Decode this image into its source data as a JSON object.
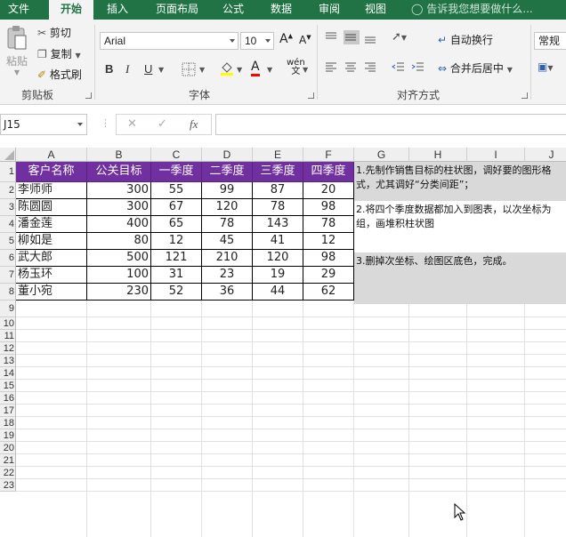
{
  "ribbon_tabs": [
    "文件",
    "开始",
    "插入",
    "页面布局",
    "公式",
    "数据",
    "审阅",
    "视图"
  ],
  "tell_me": "告诉我您想要做什么...",
  "clipboard": {
    "paste": "粘贴",
    "cut": "剪切",
    "copy": "复制",
    "format_painter": "格式刷",
    "group_label": "剪贴板"
  },
  "font": {
    "font_name": "Arial",
    "font_size": "10",
    "bold": "B",
    "italic": "I",
    "underline": "U",
    "group_label": "字体"
  },
  "alignment": {
    "wrap_text": "自动换行",
    "merge_center": "合并后居中",
    "group_label": "对齐方式"
  },
  "number": {
    "format": "常规"
  },
  "formula_bar": {
    "name_box": "J15",
    "fx": "fx",
    "formula": ""
  },
  "columns": [
    "A",
    "B",
    "C",
    "D",
    "E",
    "F",
    "G",
    "H",
    "I",
    "J"
  ],
  "rows": [
    "1",
    "2",
    "3",
    "4",
    "5",
    "6",
    "7",
    "8",
    "9",
    "10",
    "11",
    "12",
    "13",
    "14",
    "15",
    "16",
    "17",
    "18",
    "19",
    "20",
    "21",
    "22",
    "23"
  ],
  "table": {
    "headers": [
      "客户名称",
      "公关目标",
      "一季度",
      "二季度",
      "三季度",
      "四季度"
    ],
    "rows": [
      [
        "李师师",
        "300",
        "55",
        "99",
        "87",
        "20"
      ],
      [
        "陈圆圆",
        "300",
        "67",
        "120",
        "78",
        "98"
      ],
      [
        "潘金莲",
        "400",
        "65",
        "78",
        "143",
        "78"
      ],
      [
        "柳如是",
        "80",
        "12",
        "45",
        "41",
        "12"
      ],
      [
        "武大郎",
        "500",
        "121",
        "210",
        "120",
        "98"
      ],
      [
        "杨玉环",
        "100",
        "31",
        "23",
        "19",
        "29"
      ],
      [
        "董小宛",
        "230",
        "52",
        "36",
        "44",
        "62"
      ]
    ]
  },
  "notes": [
    "1.先制作销售目标的柱状图，调好要的图形格式，尤其调好“分类间距”；",
    "2.将四个季度数据都加入到图表，以次坐标为组，画堆积柱状图",
    "3.删掉次坐标、绘图区底色，完成。"
  ],
  "colors": {
    "excel_green": "#217346",
    "header_purple": "#7030a0",
    "note_gray": "#d9d9d9"
  }
}
